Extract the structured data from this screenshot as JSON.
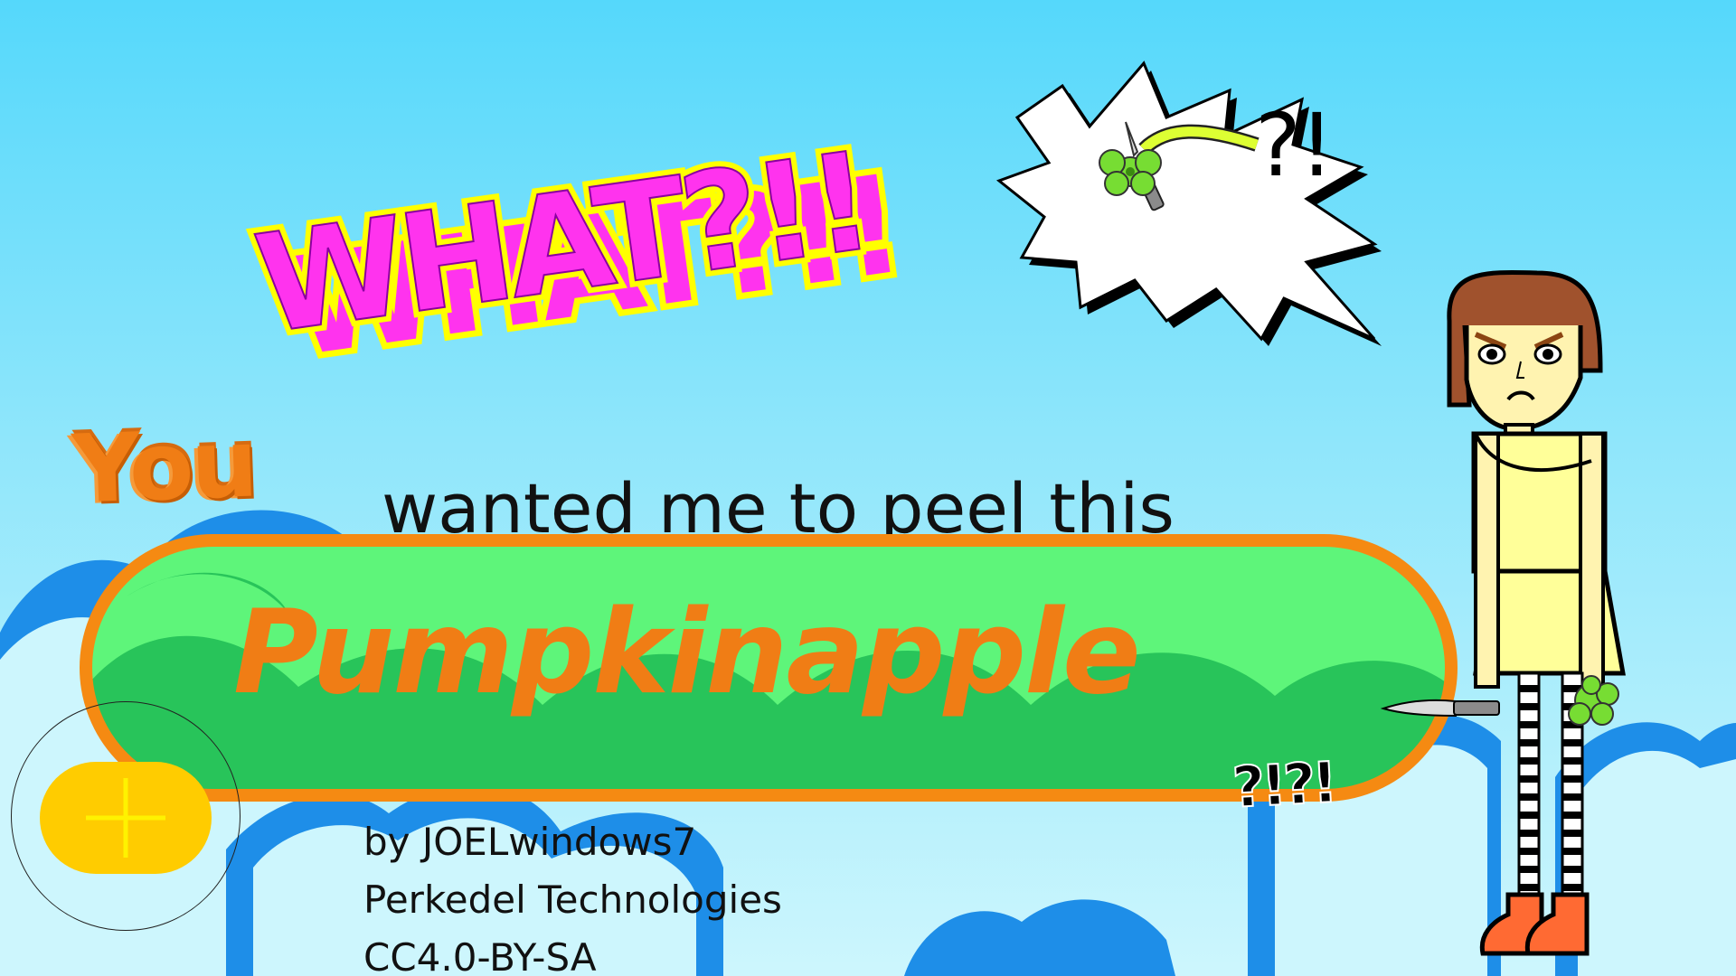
{
  "headline": "WHAT?!!",
  "speech_bubble": {
    "text": "?!",
    "icons": [
      "pumpkinapple-icon",
      "peeling-knife-icon"
    ]
  },
  "subtitle": {
    "emphasis": "You",
    "rest": "wanted me to peel this"
  },
  "banner": {
    "word": "Pumpkinapple",
    "suffix": "?!?!"
  },
  "credits": {
    "author": "by JOELwindows7",
    "studio": "Perkedel Technologies",
    "license": "CC4.0-BY-SA"
  },
  "add_button": {
    "icon": "plus-icon"
  },
  "character": {
    "name": "angry-girl-with-knife",
    "holding": [
      "knife-icon",
      "pumpkinapple-icon"
    ]
  },
  "colors": {
    "sky_top": "#55d8fb",
    "sky_bottom": "#cdf6fd",
    "headline_fill": "#ff33ee",
    "headline_outline": "#ffff00",
    "banner_fill": "#5ef57a",
    "banner_outline": "#f58a12",
    "orange_text": "#f07d15",
    "button_yellow": "#ffcc00",
    "cloud_blue": "#1e8ee8"
  }
}
